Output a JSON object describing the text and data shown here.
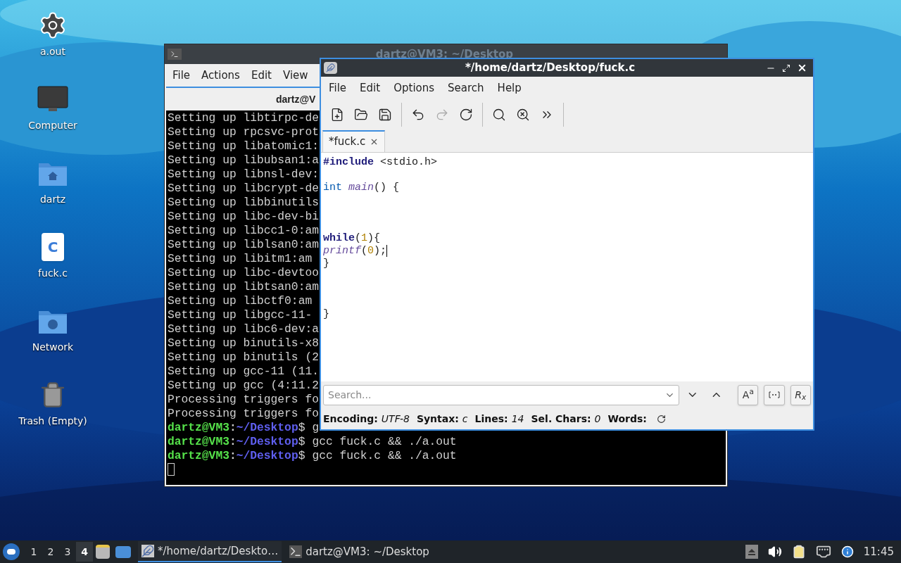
{
  "desktop_icons": [
    {
      "label": "a.out",
      "kind": "gear"
    },
    {
      "label": "Computer",
      "kind": "computer"
    },
    {
      "label": "dartz",
      "kind": "home"
    },
    {
      "label": "fuck.c",
      "kind": "source",
      "glyph": "C"
    },
    {
      "label": "Network",
      "kind": "network"
    },
    {
      "label": "Trash (Empty)",
      "kind": "trash"
    }
  ],
  "terminal": {
    "title": "dartz@VM3: ~/Desktop",
    "active": false,
    "menu": [
      "File",
      "Actions",
      "Edit",
      "View"
    ],
    "tab_title": "dartz@V",
    "output": [
      "Setting up libtirpc-de",
      "Setting up rpcsvc-prot",
      "Setting up libatomic1:",
      "Setting up libubsan1:a",
      "Setting up libnsl-dev:",
      "Setting up libcrypt-de",
      "Setting up libbinutils",
      "Setting up libc-dev-bi",
      "Setting up libcc1-0:am",
      "Setting up liblsan0:am",
      "Setting up libitm1:am",
      "Setting up libc-devtoo",
      "Setting up libtsan0:am",
      "Setting up libctf0:am",
      "Setting up libgcc-11-",
      "Setting up libc6-dev:a",
      "Setting up binutils-x8",
      "Setting up binutils (2",
      "Setting up gcc-11 (11.",
      "Setting up gcc (4:11.2",
      "Processing triggers fo",
      "Processing triggers fo"
    ],
    "prompts": [
      {
        "user": "dartz@VM3",
        "sep": ":",
        "path": "~/Desktop",
        "sign": "$",
        "command": "g"
      },
      {
        "user": "dartz@VM3",
        "sep": ":",
        "path": "~/Desktop",
        "sign": "$",
        "command": "gcc fuck.c && ./a.out"
      },
      {
        "user": "dartz@VM3",
        "sep": ":",
        "path": "~/Desktop",
        "sign": "$",
        "command": "gcc fuck.c && ./a.out"
      }
    ]
  },
  "editor": {
    "title": "*/home/dartz/Desktop/fuck.c",
    "active": true,
    "menu": [
      "File",
      "Edit",
      "Options",
      "Search",
      "Help"
    ],
    "toolbar": [
      [
        {
          "kind": "new",
          "disabled": false
        },
        {
          "kind": "open",
          "disabled": false
        },
        {
          "kind": "save",
          "disabled": false
        }
      ],
      [
        {
          "kind": "undo",
          "disabled": false
        },
        {
          "kind": "redo",
          "disabled": true
        },
        {
          "kind": "reload",
          "disabled": false
        }
      ],
      [
        {
          "kind": "find",
          "disabled": false
        },
        {
          "kind": "replace",
          "disabled": false
        },
        {
          "kind": "more",
          "disabled": false
        }
      ]
    ],
    "tabs": [
      {
        "label": "*fuck.c",
        "selected": true
      }
    ],
    "code": [
      {
        "kind": "code",
        "cursor": false,
        "tokens": [
          {
            "text": "#include",
            "kind": "keyword"
          },
          {
            "text": " <stdio.h>",
            "kind": "plain"
          }
        ]
      },
      {
        "kind": "blank",
        "cursor": false
      },
      {
        "kind": "code",
        "cursor": false,
        "tokens": [
          {
            "text": "int",
            "kind": "type"
          },
          {
            "text": " main",
            "kind": "function"
          },
          {
            "text": "() {",
            "kind": "plain"
          }
        ]
      },
      {
        "kind": "blank",
        "cursor": false
      },
      {
        "kind": "blank",
        "cursor": false
      },
      {
        "kind": "blank",
        "cursor": false
      },
      {
        "kind": "code",
        "cursor": false,
        "tokens": [
          {
            "text": "while",
            "kind": "keyword"
          },
          {
            "text": "(",
            "kind": "plain"
          },
          {
            "text": "1",
            "kind": "number"
          },
          {
            "text": "){",
            "kind": "plain"
          }
        ]
      },
      {
        "kind": "code",
        "cursor": true,
        "tokens": [
          {
            "text": "printf",
            "kind": "function"
          },
          {
            "text": "(",
            "kind": "plain"
          },
          {
            "text": "0",
            "kind": "number"
          },
          {
            "text": ");",
            "kind": "plain"
          }
        ]
      },
      {
        "kind": "code",
        "cursor": false,
        "tokens": [
          {
            "text": "}",
            "kind": "plain"
          }
        ]
      },
      {
        "kind": "blank",
        "cursor": false
      },
      {
        "kind": "blank",
        "cursor": false
      },
      {
        "kind": "blank",
        "cursor": false
      },
      {
        "kind": "code",
        "cursor": false,
        "tokens": [
          {
            "text": "}",
            "kind": "plain"
          }
        ]
      }
    ],
    "search": {
      "placeholder": "Search...",
      "toggles": [
        {
          "kind": "case",
          "label": "A$^{a}$"
        },
        {
          "kind": "word"
        },
        {
          "kind": "regex",
          "label": "R$_{x}$"
        }
      ]
    },
    "status": [
      {
        "label": "Encoding:",
        "value": "UTF-8"
      },
      {
        "label": "Syntax:",
        "value": "c"
      },
      {
        "label": "Lines:",
        "value": "14"
      },
      {
        "label": "Sel. Chars:",
        "value": "0"
      },
      {
        "label": "Words:"
      }
    ]
  },
  "taskbar": {
    "workspaces": [
      {
        "label": "1",
        "selected": false
      },
      {
        "label": "2",
        "selected": false
      },
      {
        "label": "3",
        "selected": false
      },
      {
        "label": "4",
        "selected": true
      }
    ],
    "tasks": [
      {
        "label": "*/home/dartz/Deskto…",
        "kind": "editor",
        "selected": true
      },
      {
        "label": "dartz@VM3: ~/Desktop",
        "kind": "terminal",
        "selected": false
      }
    ],
    "clock": "11:45"
  }
}
